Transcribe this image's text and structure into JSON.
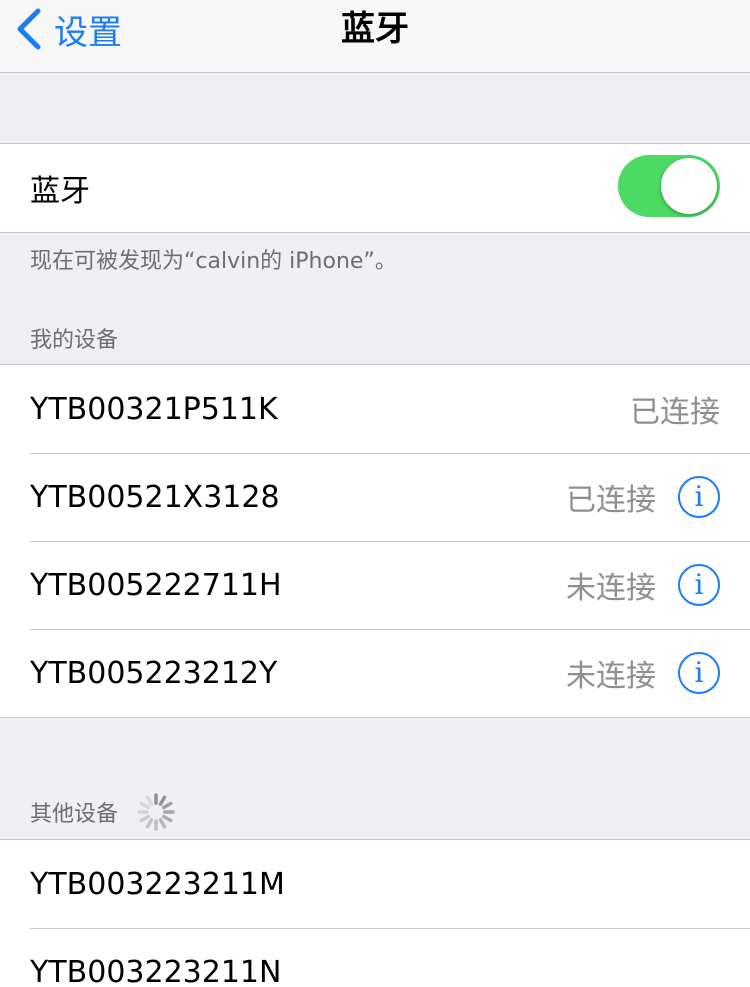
{
  "nav": {
    "back_label": "设置",
    "title": "蓝牙"
  },
  "bluetooth": {
    "label": "蓝牙",
    "enabled": true,
    "toggle_color": "#4cd964",
    "discoverable_text": "现在可被发现为“calvin的 iPhone”。"
  },
  "my_devices": {
    "header": "我的设备",
    "items": [
      {
        "name": "YTB00321P511K",
        "status": "已连接",
        "info": false
      },
      {
        "name": "YTB00521X3128",
        "status": "已连接",
        "info": true
      },
      {
        "name": "YTB005222711H",
        "status": "未连接",
        "info": true
      },
      {
        "name": "YTB005223212Y",
        "status": "未连接",
        "info": true
      }
    ]
  },
  "other_devices": {
    "header": "其他设备",
    "items": [
      {
        "name": "YTB003223211M"
      },
      {
        "name": "YTB003223211N"
      }
    ]
  },
  "icons": {
    "back": "chevron-left-icon",
    "info": "info-icon",
    "spinner": "loading-spinner-icon",
    "info_glyph": "i"
  },
  "colors": {
    "accent": "#1a7cf6",
    "background": "#efeff4",
    "secondary_text": "#8e8e93"
  }
}
